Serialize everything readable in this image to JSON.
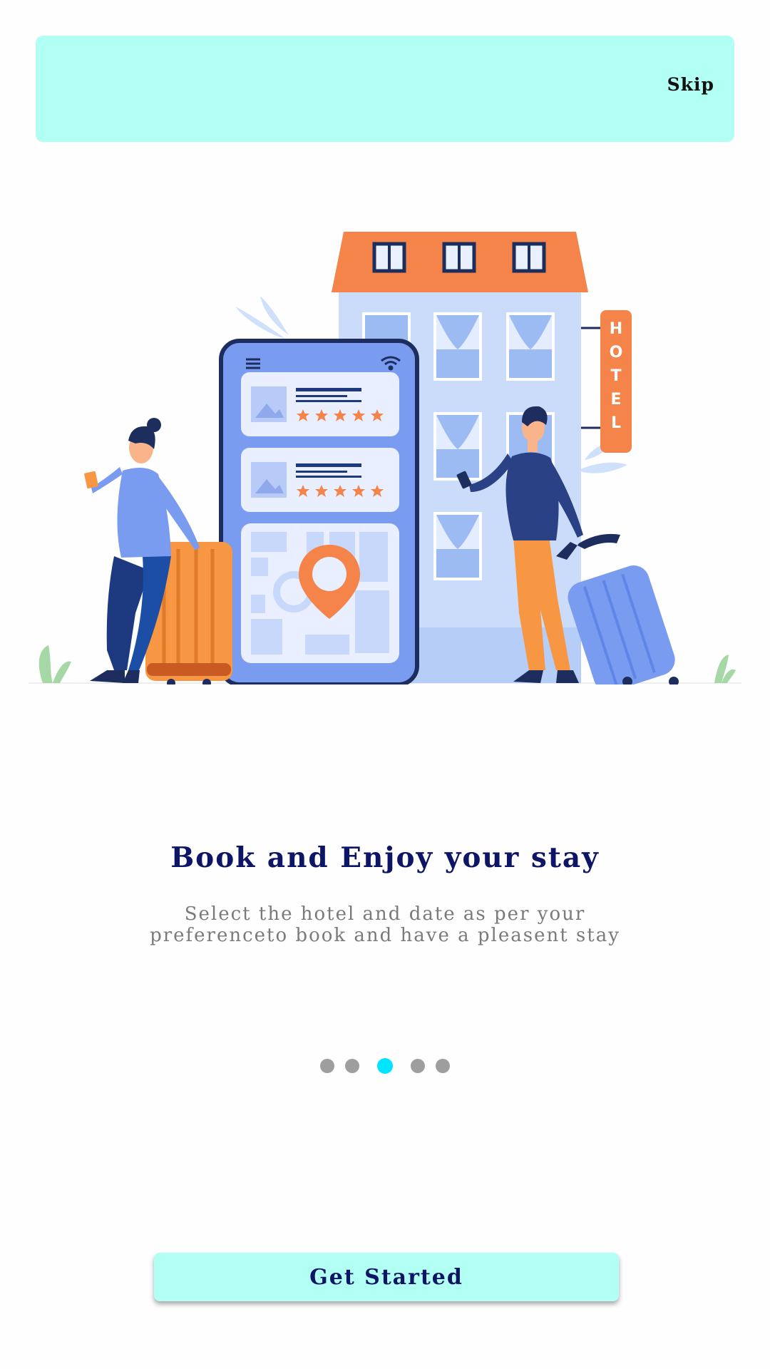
{
  "header": {
    "skip_label": "Skip"
  },
  "illustration": {
    "sign_text": "HOTEL"
  },
  "onboarding": {
    "title": "Book and Enjoy your stay",
    "subtitle_line1": "Select the hotel and date as per your",
    "subtitle_line2": "preferenceto book and have a pleasent stay"
  },
  "pager": {
    "total": 5,
    "active_index": 2,
    "active_color": "#00e5ff",
    "inactive_color": "#9e9e9e"
  },
  "footer": {
    "cta_label": "Get Started"
  },
  "colors": {
    "accent": "#b2fff3",
    "title": "#0e1566",
    "subtitle": "#7a7a7a"
  }
}
